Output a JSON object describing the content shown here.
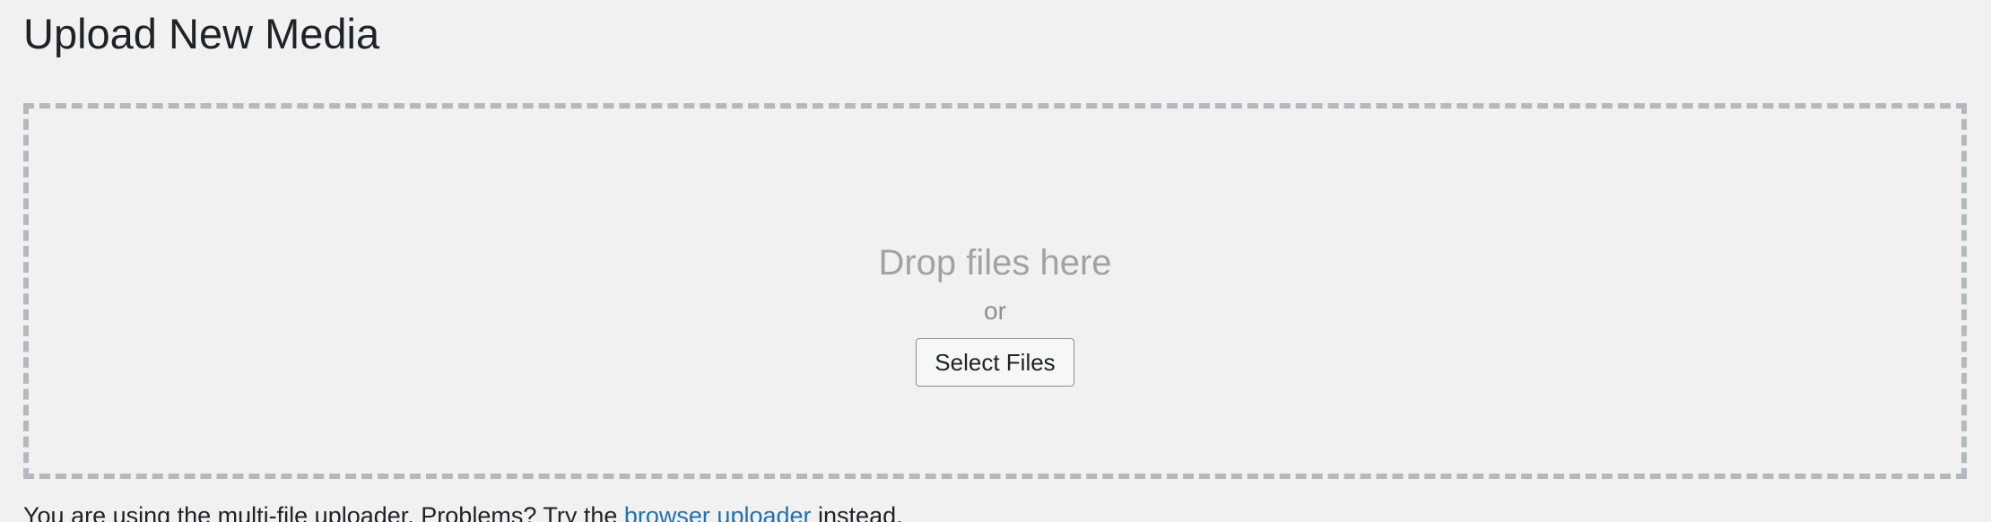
{
  "page": {
    "title": "Upload New Media"
  },
  "uploader": {
    "drop_text": "Drop files here",
    "or_text": "or",
    "select_button_label": "Select Files"
  },
  "status": {
    "prefix": "You are using the multi-file uploader. Problems? Try the",
    "link_label": "browser uploader",
    "suffix": "instead."
  },
  "colors": {
    "background": "#f1f1f1",
    "dashed_border": "#b4b9be",
    "link": "#2271b1",
    "muted_text": "#9fa3a6"
  }
}
